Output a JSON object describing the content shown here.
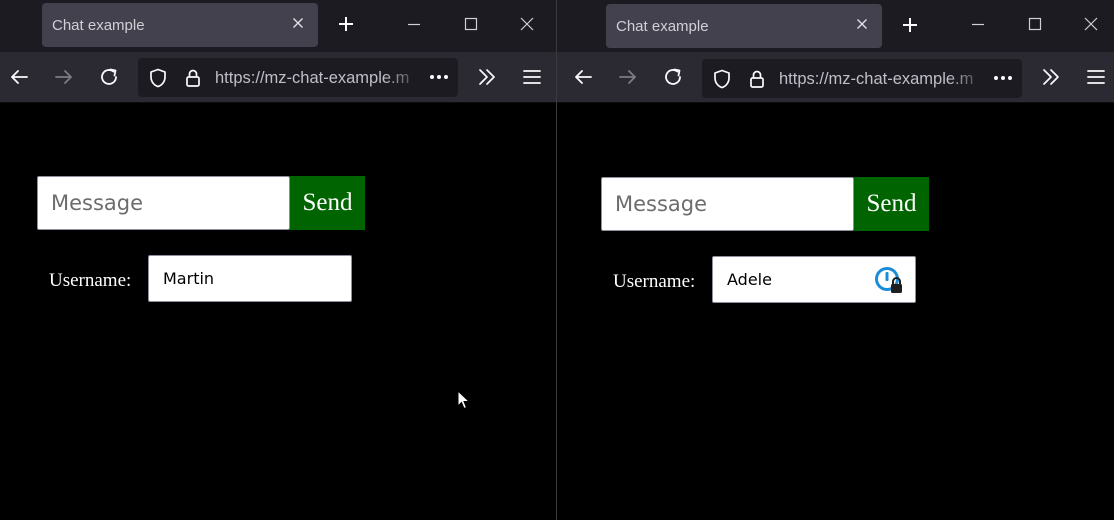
{
  "windows": [
    {
      "tab_title": "Chat example",
      "url": "https://mz-chat-example.m",
      "message_placeholder": "Message",
      "send_label": "Send",
      "username_label": "Username:",
      "username_value": "Martin"
    },
    {
      "tab_title": "Chat example",
      "url": "https://mz-chat-example.m",
      "message_placeholder": "Message",
      "send_label": "Send",
      "username_label": "Username:",
      "username_value": "Adele",
      "password_manager_icon": "password-manager-lock-icon"
    }
  ],
  "icons": {
    "tab_close": "close-icon",
    "new_tab": "plus-icon",
    "minimize": "minimize-icon",
    "maximize": "maximize-icon",
    "close_window": "close-icon",
    "back": "back-arrow-icon",
    "forward": "forward-arrow-icon",
    "reload": "reload-icon",
    "tracking_protection": "shield-icon",
    "secure_connection": "lock-icon",
    "page_actions": "more-horizontal-icon",
    "overflow": "chevrons-right-icon",
    "app_menu": "hamburger-menu-icon",
    "pointer": "mouse-cursor-icon"
  },
  "colors": {
    "titlebar": "#1c1b22",
    "active_tab": "#42414d",
    "toolbar": "#2b2a33",
    "urlbar": "#1c1b22",
    "page_background": "#000000",
    "send_button": "#006400",
    "password_manager_accent": "#1a8cd8"
  }
}
